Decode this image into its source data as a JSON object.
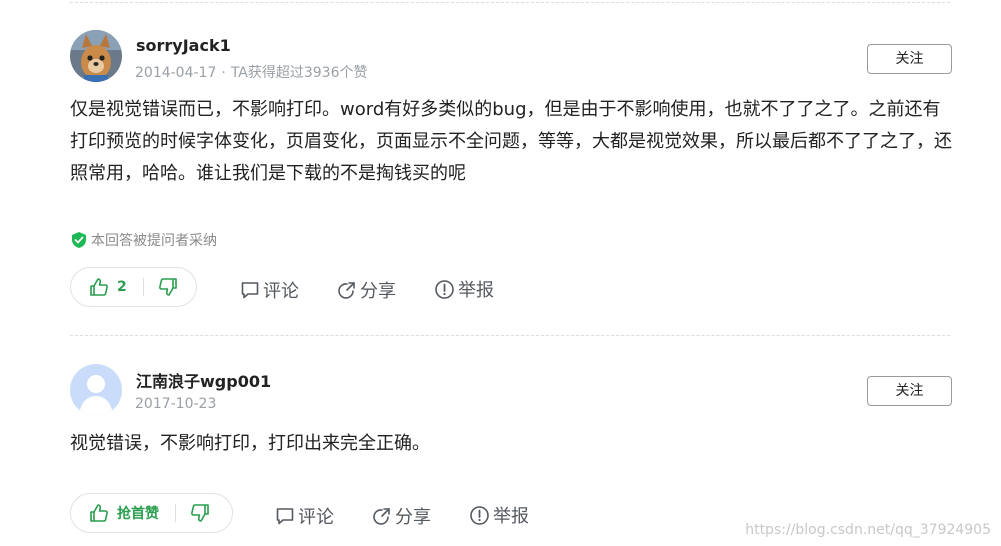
{
  "answers": [
    {
      "username": "sorryJack1",
      "date": "2014-04-17",
      "separator": "·",
      "likes_text": "TA获得超过3936个赞",
      "follow_label": "关注",
      "content": "仅是视觉错误而已，不影响打印。word有好多类似的bug，但是由于不影响使用，也就不了了之了。之前还有打印预览的时候字体变化，页眉变化，页面显示不全问题，等等，大都是视觉效果，所以最后都不了了之了，还照常用，哈哈。谁让我们是下载的不是掏钱买的呢",
      "accepted_text": "本回答被提问者采纳",
      "upvote_count": "2",
      "comment_label": "评论",
      "share_label": "分享",
      "report_label": "举报"
    },
    {
      "username": "江南浪子wgp001",
      "date": "2017-10-23",
      "follow_label": "关注",
      "content": "视觉错误，不影响打印，打印出来完全正确。",
      "upvote_label": "抢首赞",
      "comment_label": "评论",
      "share_label": "分享",
      "report_label": "举报"
    }
  ],
  "watermark": "https://blog.csdn.net/qq_37924905",
  "colors": {
    "accent_green": "#2a9d4e",
    "accepted_green": "#1db954",
    "text_gray": "#9aa0a6"
  },
  "icons": [
    "thumbs-up-icon",
    "thumbs-down-icon",
    "comment-icon",
    "share-icon",
    "report-icon",
    "shield-check-icon"
  ]
}
